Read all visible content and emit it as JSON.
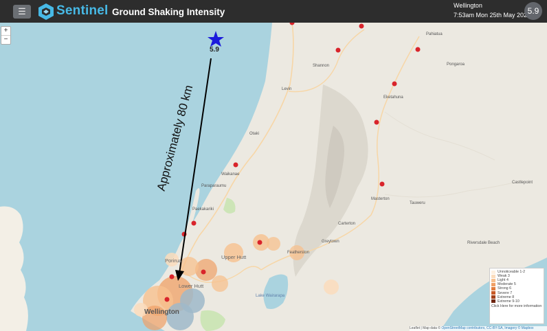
{
  "header": {
    "brand": "Sentinel",
    "title": "Ground Shaking Intensity",
    "location": "Wellington",
    "datetime": "7:53am Mon 25th May 2020",
    "magnitude": "5.9",
    "menu_icon": "hamburger-icon",
    "logo_icon": "sentinel-logo-icon"
  },
  "map": {
    "zoom_in": "+",
    "zoom_out": "−",
    "epicenter_icon": "star-icon",
    "epicenter_label": "5.9",
    "distance_label": "Approximately 80 km",
    "towns": {
      "pahiatua": "Pahiatua",
      "shannon": "Shannon",
      "pongaroa": "Pongaroa",
      "levin": "Levin",
      "ekatahuna": "Eketahuna",
      "otaki": "Otaki",
      "waikanae": "Waikanae",
      "paraparaumu": "Paraparaumu",
      "castlepoint": "Castlepoint",
      "masterton": "Masterton",
      "tauweru": "Tauweru",
      "paekakariki": "Paekakariki",
      "carterton": "Carterton",
      "greytown": "Greytown",
      "riversdale": "Riversdale Beach",
      "featherston": "Featherston",
      "porirua": "Porirua",
      "upper_hutt": "Upper Hutt",
      "lower_hutt": "Lower Hutt",
      "lake": "Lake Wairarapa",
      "wellington": "Wellington"
    },
    "legend": [
      {
        "label": "Unnoticeable 1-2",
        "color": "#fdf0e0"
      },
      {
        "label": "Weak 3",
        "color": "#fbdcbc"
      },
      {
        "label": "Light 4",
        "color": "#f7c08e"
      },
      {
        "label": "Moderate 5",
        "color": "#f0a066"
      },
      {
        "label": "Strong 6",
        "color": "#e27d3e"
      },
      {
        "label": "Severe 7",
        "color": "#c85a26"
      },
      {
        "label": "Extreme 8",
        "color": "#a3401a"
      },
      {
        "label": "Extreme 9-10",
        "color": "#6e2610"
      }
    ],
    "legend_link": "Click Here for more information",
    "attribution_prefix": "Leaflet | Map data ©",
    "attribution_link": "OpenStreetMap contributors, CC-BY-SA, Imagery © Mapbox"
  }
}
